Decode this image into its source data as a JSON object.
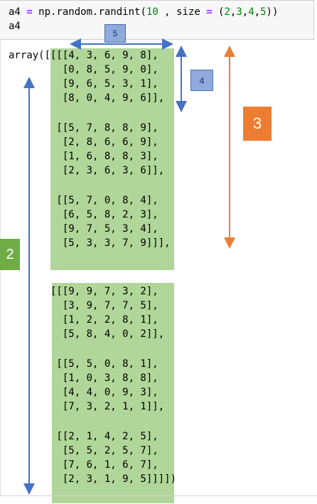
{
  "input": {
    "line1": {
      "var": "a4 ",
      "op": "=",
      "call": " np.random.randint(",
      "num1": "10",
      "sep": " , size ",
      "eq": "=",
      "tuple_open": " (",
      "n2": "2",
      "c1": ",",
      "n3": "3",
      "c2": ",",
      "n4": "4",
      "c3": ",",
      "n5": "5",
      "close": "))"
    },
    "line2": "a4"
  },
  "output": {
    "lines": [
      "array([[[[4, 3, 6, 9, 8],",
      "         [0, 8, 5, 9, 0],",
      "         [9, 6, 5, 3, 1],",
      "         [8, 0, 4, 9, 6]],",
      "",
      "        [[5, 7, 8, 8, 9],",
      "         [2, 8, 6, 6, 9],",
      "         [1, 6, 8, 8, 3],",
      "         [2, 3, 6, 3, 6]],",
      "",
      "        [[5, 7, 0, 8, 4],",
      "         [6, 5, 8, 2, 3],",
      "         [9, 7, 5, 3, 4],",
      "         [5, 3, 3, 7, 9]]],",
      "",
      "",
      "       [[[9, 9, 7, 3, 2],",
      "         [3, 9, 7, 7, 5],",
      "         [1, 2, 2, 8, 1],",
      "         [5, 8, 4, 0, 2]],",
      "",
      "        [[5, 5, 0, 8, 1],",
      "         [1, 0, 3, 8, 8],",
      "         [4, 4, 0, 9, 3],",
      "         [7, 3, 2, 1, 1]],",
      "",
      "        [[2, 1, 4, 2, 5],",
      "         [5, 5, 2, 5, 7],",
      "         [7, 6, 1, 6, 7],",
      "         [2, 3, 1, 9, 5]]]])"
    ]
  },
  "annotations": {
    "label5": "5",
    "label4": "4",
    "label3": "3",
    "label2": "2",
    "colors": {
      "green_highlight": "#a9d18e",
      "blue_arrow": "#4472c4",
      "orange_arrow": "#ed7d31",
      "box_blue": "#8faadc",
      "box_orange": "#ed7d31",
      "box_green": "#70ad47"
    }
  }
}
